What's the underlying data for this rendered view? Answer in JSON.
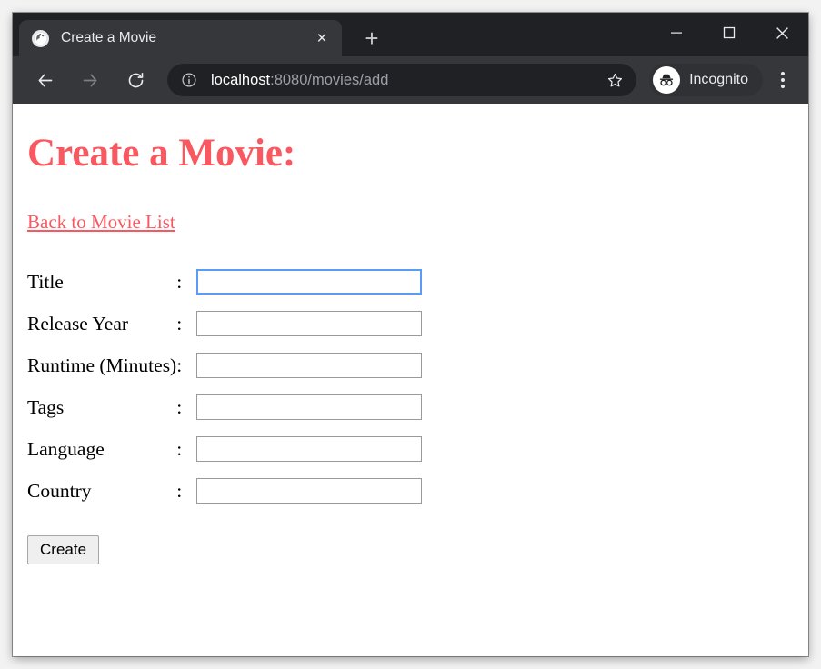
{
  "browser": {
    "tab": {
      "title": "Create a Movie",
      "favicon": "globe-icon",
      "close_label": "×"
    },
    "new_tab_label": "+",
    "window_controls": {
      "minimize": "minimize-icon",
      "maximize": "maximize-icon",
      "close": "close-icon"
    },
    "toolbar": {
      "back": "back-arrow-icon",
      "forward": "forward-arrow-icon",
      "reload": "reload-icon",
      "site_info": "info-circle-icon",
      "url_host": "localhost",
      "url_path": ":8080/movies/add",
      "bookmark": "star-icon",
      "incognito_label": "Incognito",
      "incognito_icon": "incognito-hat-glasses-icon",
      "menu": "kebab-menu-icon"
    }
  },
  "page": {
    "title": "Create a Movie:",
    "back_link": "Back to Movie List",
    "accent_color": "#fa5860",
    "focus_color": "#5b9bf8",
    "colon": ":",
    "fields": [
      {
        "label": "Title",
        "value": "",
        "placeholder": "",
        "focused": true
      },
      {
        "label": "Release Year",
        "value": "",
        "placeholder": "",
        "focused": false
      },
      {
        "label": "Runtime (Minutes)",
        "value": "",
        "placeholder": "",
        "focused": false
      },
      {
        "label": "Tags",
        "value": "",
        "placeholder": "",
        "focused": false
      },
      {
        "label": "Language",
        "value": "",
        "placeholder": "",
        "focused": false
      },
      {
        "label": "Country",
        "value": "",
        "placeholder": "",
        "focused": false
      }
    ],
    "submit_label": "Create"
  }
}
